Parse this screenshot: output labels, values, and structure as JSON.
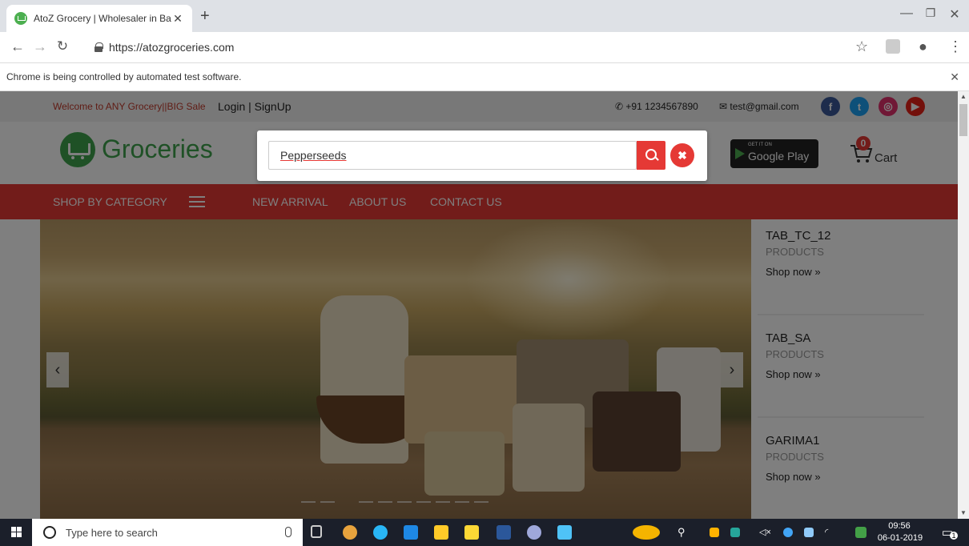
{
  "browser": {
    "tab_title": "AtoZ Grocery | Wholesaler in Ban",
    "url": "https://atozgroceries.com",
    "infobar_text": "Chrome is being controlled by automated test software."
  },
  "topbar": {
    "welcome": "Welcome to ANY Grocery||BIG Sale",
    "login": "Login | SignUp",
    "phone": "+91 1234567890",
    "email": "test@gmail.com"
  },
  "header": {
    "logo_text": "Groceries",
    "gplay_small": "GET IT ON",
    "gplay_big": "Google Play",
    "cart_count": "0",
    "cart_label": "Cart"
  },
  "nav": {
    "shop_by_category": "SHOP BY CATEGORY",
    "new_arrival": "NEW ARRIVAL",
    "about_us": "ABOUT US",
    "contact_us": "CONTACT US"
  },
  "side_cards": [
    {
      "name": "TAB_TC_12",
      "sub": "PRODUCTS",
      "link": "Shop now »"
    },
    {
      "name": "TAB_SA",
      "sub": "PRODUCTS",
      "link": "Shop now »"
    },
    {
      "name": "GARIMA1",
      "sub": "PRODUCTS",
      "link": "Shop now »"
    }
  ],
  "search": {
    "value": "Pepperseeds"
  },
  "taskbar": {
    "search_placeholder": "Type here to search",
    "time": "09:56",
    "date": "06-01-2019",
    "notification_count": "1"
  },
  "colors": {
    "brand_red": "#e53935",
    "brand_green": "#3ea24d"
  }
}
